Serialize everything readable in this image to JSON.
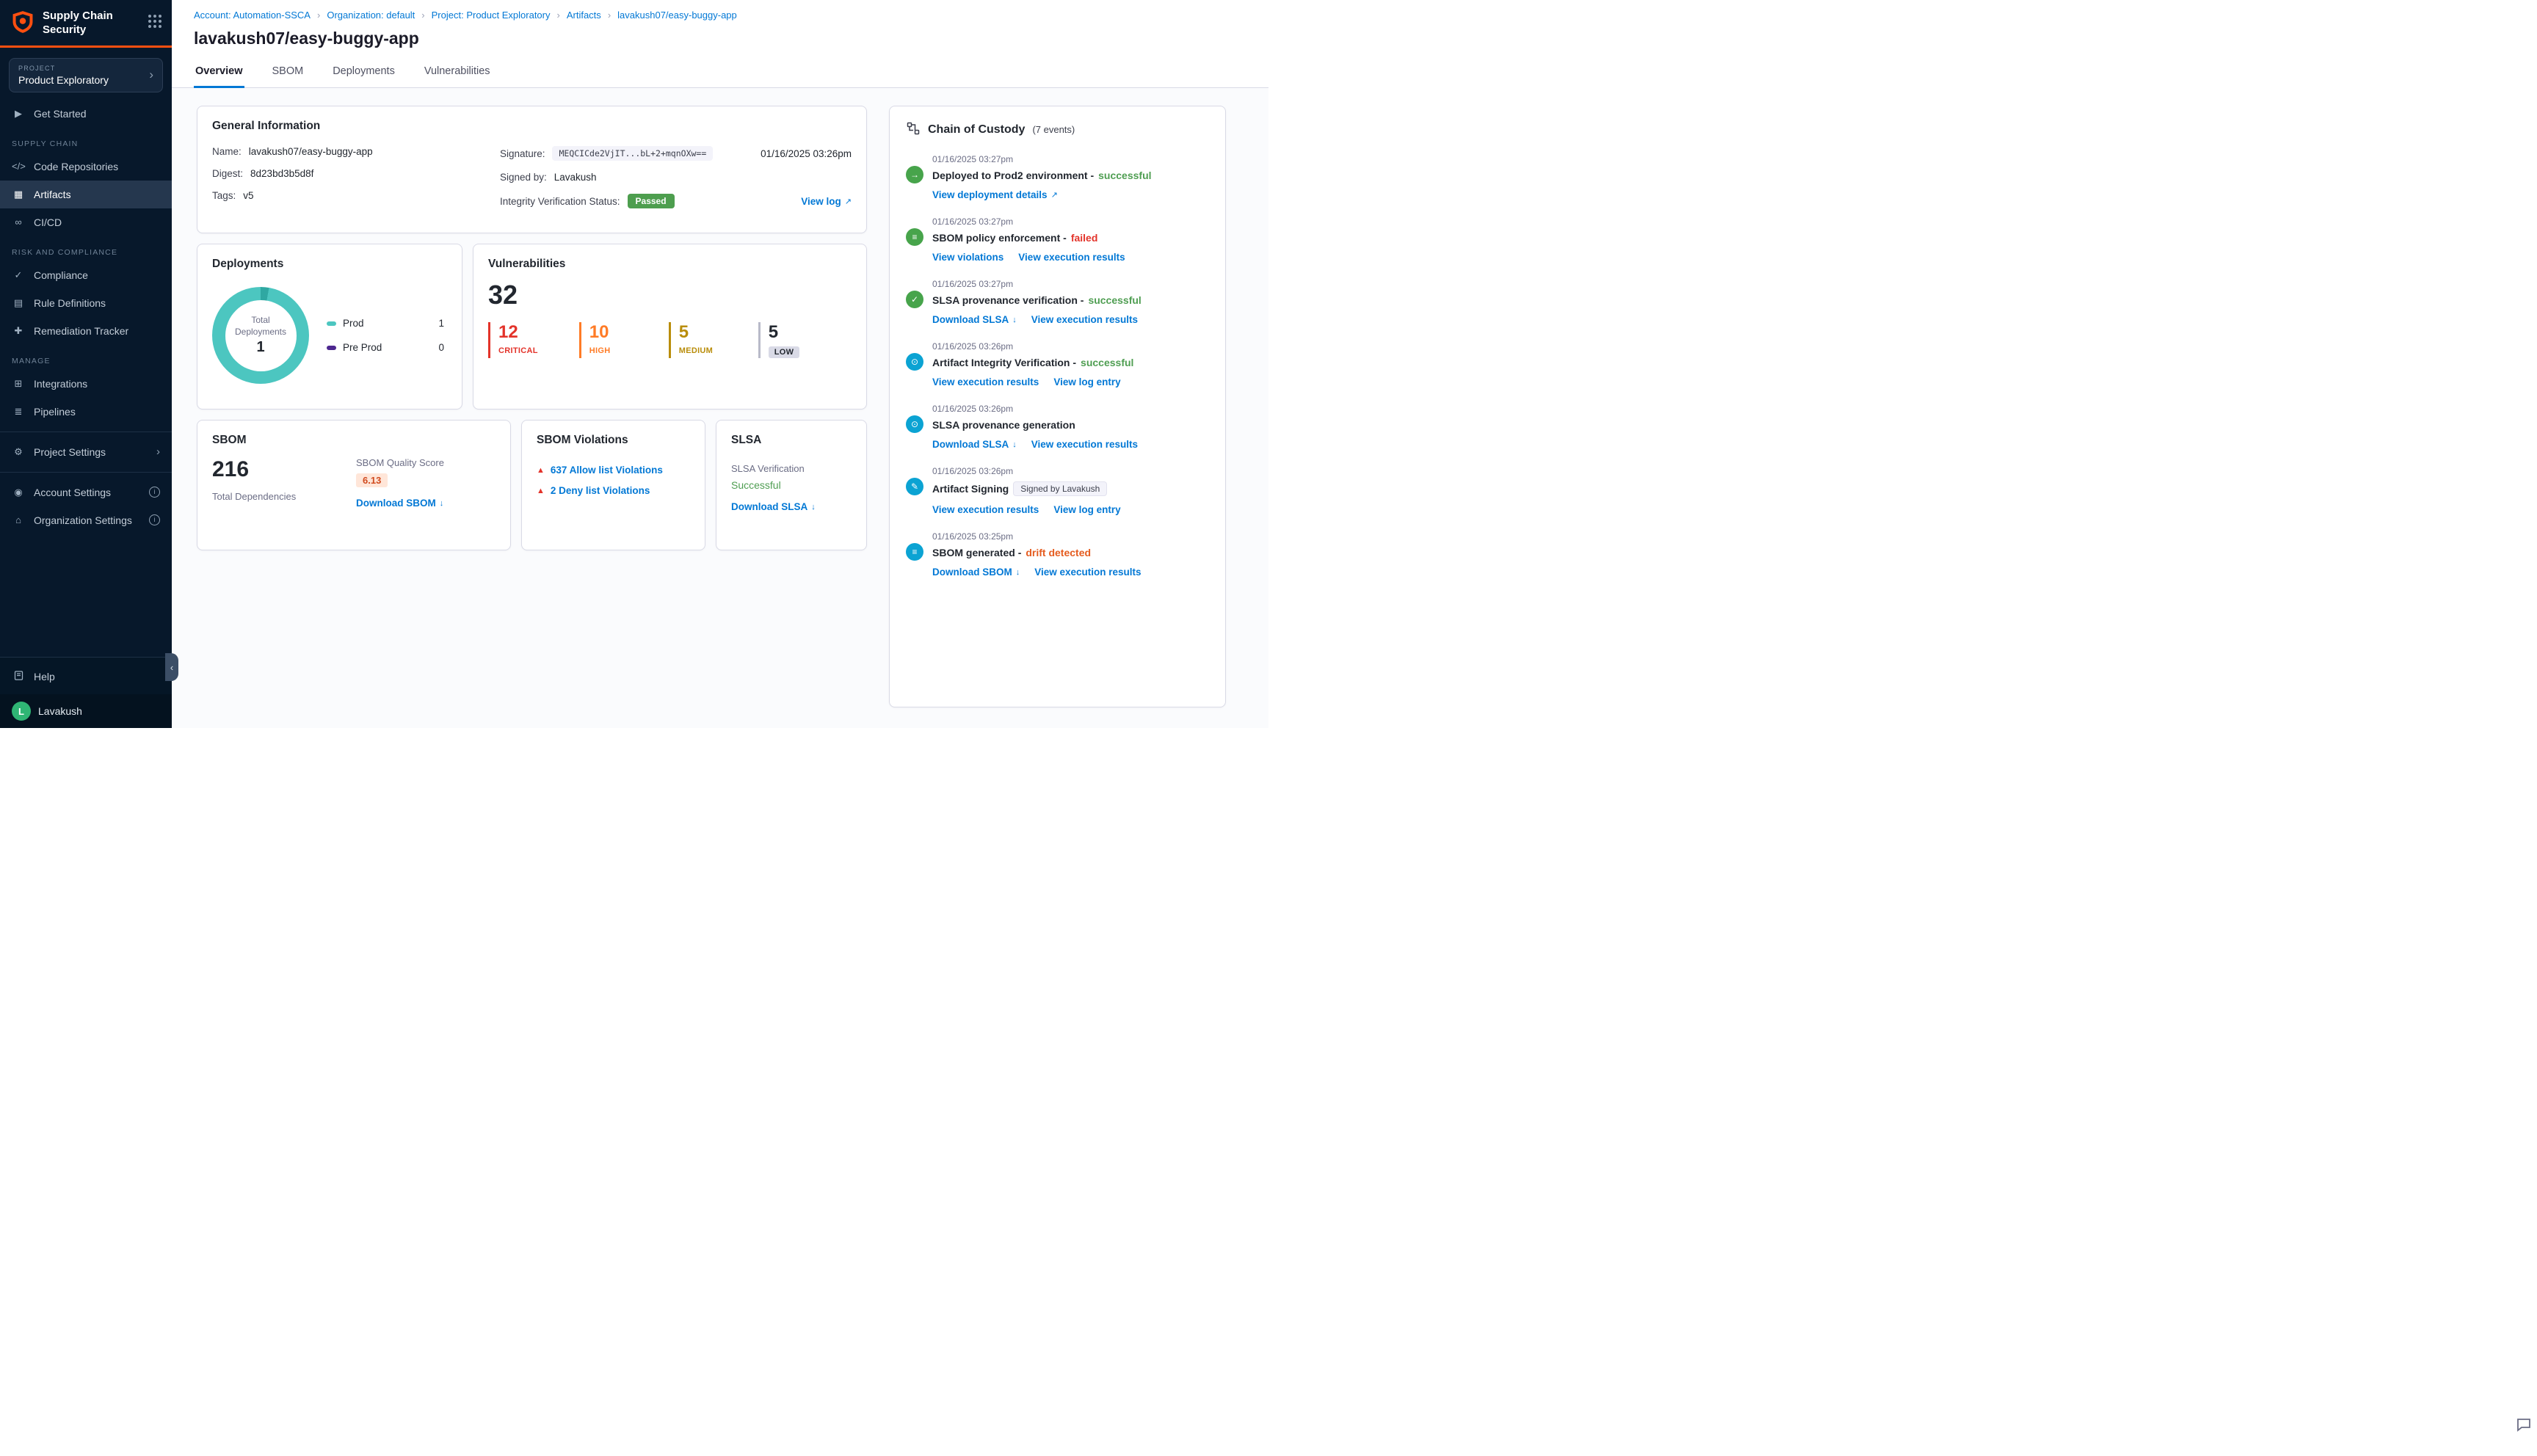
{
  "app": {
    "title": "Supply Chain Security"
  },
  "ui": {
    "external_glyph": "↗",
    "download_glyph": "↓",
    "chevron_right": "›",
    "collapse_glyph": "‹",
    "info_glyph": "i",
    "warning_glyph": "▲"
  },
  "colors": {
    "accent_blue": "#0278d5",
    "success_green": "#4F9E52",
    "critical_red": "#E3332A",
    "high_orange": "#FF7B26",
    "medium_yellow": "#B98D0B",
    "low_gray": "#B9BAC9",
    "donut_teal": "#4CC6C0",
    "preprod_purple": "#4D278F",
    "sidebar_navy": "#07182B",
    "passed_badge_green": "#4D9E4E",
    "logo_orange": "#FF4F10"
  },
  "icons": {
    "app-logo": "shield (orange)",
    "app-switcher-icon": "3x3 dot grid (css)",
    "chain-of-custody-icon": "steps svg",
    "feedback-icon": "speech bubble svg"
  },
  "sidebar": {
    "project_label": "PROJECT",
    "project_name": "Product Exploratory",
    "items": [
      {
        "type": "link",
        "label": "Get Started",
        "glyph": "▶"
      },
      {
        "type": "header",
        "label": "SUPPLY CHAIN"
      },
      {
        "type": "link",
        "label": "Code Repositories",
        "glyph": "</>"
      },
      {
        "type": "link",
        "label": "Artifacts",
        "glyph": "▦",
        "active": true
      },
      {
        "type": "link",
        "label": "CI/CD",
        "glyph": "∞"
      },
      {
        "type": "header",
        "label": "RISK AND COMPLIANCE"
      },
      {
        "type": "link",
        "label": "Compliance",
        "glyph": "✓"
      },
      {
        "type": "link",
        "label": "Rule Definitions",
        "glyph": "▤"
      },
      {
        "type": "link",
        "label": "Remediation Tracker",
        "glyph": "✚"
      },
      {
        "type": "header",
        "label": "MANAGE"
      },
      {
        "type": "link",
        "label": "Integrations",
        "glyph": "⊞"
      },
      {
        "type": "link",
        "label": "Pipelines",
        "glyph": "≣"
      },
      {
        "type": "link",
        "label": "Project Settings",
        "glyph": "⚙"
      },
      {
        "type": "link",
        "label": "Account Settings",
        "glyph": "◉"
      },
      {
        "type": "link",
        "label": "Organization Settings",
        "glyph": "⌂"
      }
    ],
    "help_label": "Help",
    "user_name": "Lavakush",
    "user_initial": "L"
  },
  "breadcrumb": [
    "Account: Automation-SSCA",
    "Organization: default",
    "Project: Product Exploratory",
    "Artifacts",
    "lavakush07/easy-buggy-app"
  ],
  "page_title": "lavakush07/easy-buggy-app",
  "tabs": [
    {
      "label": "Overview",
      "active": true
    },
    {
      "label": "SBOM"
    },
    {
      "label": "Deployments"
    },
    {
      "label": "Vulnerabilities"
    }
  ],
  "general_info": {
    "title": "General Information",
    "name_label": "Name:",
    "name_value": "lavakush07/easy-buggy-app",
    "digest_label": "Digest:",
    "digest_value": "8d23bd3b5d8f",
    "tags_label": "Tags:",
    "tags_value": "v5",
    "signature_label": "Signature:",
    "signature_value": "MEQCICde2VjIT...bL+2+mqnOXw==",
    "signature_date": "01/16/2025 03:26pm",
    "signed_by_label": "Signed by:",
    "signed_by_value": "Lavakush",
    "integrity_label": "Integrity Verification Status:",
    "integrity_status": "Passed",
    "view_log_label": "View log"
  },
  "deployments": {
    "title": "Deployments",
    "center_label": "Total Deployments",
    "center_value": "1",
    "legend": [
      {
        "label": "Prod",
        "value": "1"
      },
      {
        "label": "Pre Prod",
        "value": "0"
      }
    ]
  },
  "vulnerabilities": {
    "title": "Vulnerabilities",
    "total": "32",
    "severities": [
      {
        "count": "12",
        "label": "CRITICAL"
      },
      {
        "count": "10",
        "label": "HIGH"
      },
      {
        "count": "5",
        "label": "MEDIUM"
      },
      {
        "count": "5",
        "label": "LOW"
      }
    ]
  },
  "sbom": {
    "title": "SBOM",
    "total": "216",
    "total_label": "Total Dependencies",
    "quality_label": "SBOM Quality Score",
    "quality_value": "6.13",
    "download_label": "Download SBOM"
  },
  "sbom_violations": {
    "title": "SBOM Violations",
    "items": [
      {
        "label": "637 Allow list Violations"
      },
      {
        "label": "2 Deny list Violations"
      }
    ]
  },
  "slsa": {
    "title": "SLSA",
    "verification_label": "SLSA Verification",
    "status": "Successful",
    "download_label": "Download SLSA"
  },
  "chain": {
    "title": "Chain of Custody",
    "count": "(7 events)",
    "events": [
      {
        "time": "01/16/2025 03:27pm",
        "title": "Deployed to Prod2 environment -",
        "status": "successful",
        "glyph": "→",
        "links": [
          {
            "label": "View deployment details",
            "icon": "external"
          }
        ]
      },
      {
        "time": "01/16/2025 03:27pm",
        "title": "SBOM policy enforcement -",
        "status": "failed",
        "glyph": "≡",
        "links": [
          {
            "label": "View violations"
          },
          {
            "label": "View execution results"
          }
        ]
      },
      {
        "time": "01/16/2025 03:27pm",
        "title": "SLSA provenance verification -",
        "status": "successful",
        "glyph": "✓",
        "links": [
          {
            "label": "Download SLSA",
            "icon": "download"
          },
          {
            "label": "View execution results"
          }
        ]
      },
      {
        "time": "01/16/2025 03:26pm",
        "title": "Artifact Integrity Verification -",
        "status": "successful",
        "glyph": "⊙",
        "links": [
          {
            "label": "View execution results"
          },
          {
            "label": "View log entry"
          }
        ]
      },
      {
        "time": "01/16/2025 03:26pm",
        "title": "SLSA provenance generation",
        "status": "",
        "glyph": "⊙",
        "links": [
          {
            "label": "Download SLSA",
            "icon": "download"
          },
          {
            "label": "View execution results"
          }
        ]
      },
      {
        "time": "01/16/2025 03:26pm",
        "title": "Artifact Signing",
        "badge": "Signed by Lavakush",
        "glyph": "✎",
        "links": [
          {
            "label": "View execution results"
          },
          {
            "label": "View log entry"
          }
        ]
      },
      {
        "time": "01/16/2025 03:25pm",
        "title": "SBOM generated -",
        "status": "drift detected",
        "glyph": "≡",
        "links": [
          {
            "label": "Download SBOM",
            "icon": "download"
          },
          {
            "label": "View execution results"
          }
        ]
      }
    ]
  }
}
